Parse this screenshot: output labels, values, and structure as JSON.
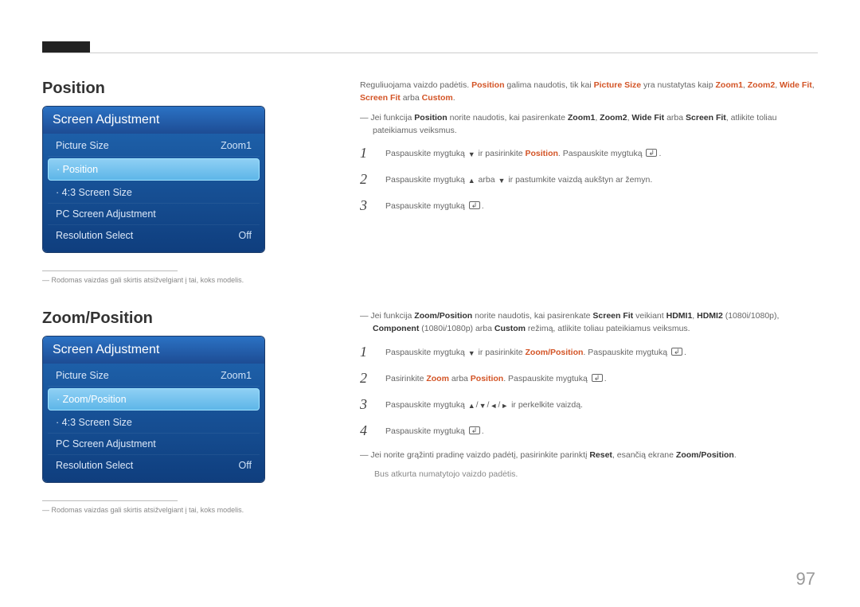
{
  "page_number": "97",
  "section1": {
    "title": "Position",
    "menu": {
      "header": "Screen Adjustment",
      "picture_size_label": "Picture Size",
      "picture_size_value": "Zoom1",
      "selected_label": "Position",
      "four_three_label": "4:3 Screen Size",
      "pc_adjust_label": "PC Screen Adjustment",
      "resolution_label": "Resolution Select",
      "resolution_value": "Off"
    },
    "footnote": "Rodomas vaizdas gali skirtis atsižvelgiant į tai, koks modelis.",
    "intro": {
      "pre": "Reguliuojama vaizdo padėtis. ",
      "hl1": "Position",
      "mid1": " galima naudotis, tik kai ",
      "hl2": "Picture Size",
      "mid2": " yra nustatytas kaip ",
      "hl3": "Zoom1",
      "sep1": ", ",
      "hl4": "Zoom2",
      "sep2": ", ",
      "hl5": "Wide Fit",
      "sep3": ", ",
      "hl6": "Screen Fit",
      "mid3": " arba ",
      "hl7": "Custom",
      "end": "."
    },
    "dash": {
      "pre": "Jei funkcija ",
      "b1": "Position",
      "mid1": " norite naudotis, kai pasirenkate ",
      "b2": "Zoom1",
      "sep1": ", ",
      "b3": "Zoom2",
      "sep2": ", ",
      "b4": "Wide Fit",
      "mid2": " arba ",
      "b5": "Screen Fit",
      "end": ", atlikite toliau pateikiamus veiksmus."
    },
    "steps": {
      "s1": {
        "a": "Paspauskite mygtuką ",
        "b": " ir pasirinkite ",
        "hl": "Position",
        "c": ". Paspauskite mygtuką ",
        "d": "."
      },
      "s2": {
        "a": "Paspauskite mygtuką ",
        "b": " arba ",
        "c": " ir pastumkite vaizdą aukštyn ar žemyn."
      },
      "s3": {
        "a": "Paspauskite mygtuką ",
        "b": "."
      }
    }
  },
  "section2": {
    "title": "Zoom/Position",
    "menu": {
      "header": "Screen Adjustment",
      "picture_size_label": "Picture Size",
      "picture_size_value": "Zoom1",
      "selected_label": "Zoom/Position",
      "four_three_label": "4:3 Screen Size",
      "pc_adjust_label": "PC Screen Adjustment",
      "resolution_label": "Resolution Select",
      "resolution_value": "Off"
    },
    "footnote": "Rodomas vaizdas gali skirtis atsižvelgiant į tai, koks modelis.",
    "dash": {
      "pre": "Jei funkcija ",
      "b1": "Zoom/Position",
      "mid1": " norite naudotis, kai pasirenkate ",
      "b2": "Screen Fit",
      "mid2": " veikiant ",
      "b3": "HDMI1",
      "sep1": ", ",
      "b4": "HDMI2",
      "paren1": " (1080i/1080p), ",
      "b5": "Component",
      "paren2": " (1080i/1080p) arba ",
      "b6": "Custom",
      "end": " režimą, atlikite toliau pateikiamus veiksmus."
    },
    "steps": {
      "s1": {
        "a": "Paspauskite mygtuką ",
        "b": " ir pasirinkite ",
        "hl": "Zoom/Position",
        "c": ". Paspauskite mygtuką ",
        "d": "."
      },
      "s2": {
        "a": "Pasirinkite ",
        "hl1": "Zoom",
        "mid": " arba ",
        "hl2": "Position",
        "b": ". Paspauskite mygtuką ",
        "c": "."
      },
      "s3": {
        "a": "Paspauskite mygtuką ",
        "b": " ir perkelkite vaizdą."
      },
      "s4": {
        "a": "Paspauskite mygtuką ",
        "b": "."
      }
    },
    "dash2": {
      "pre": "Jei norite grąžinti pradinę vaizdo padėtį, pasirinkite parinktį ",
      "b1": "Reset",
      "mid": ", esančią ekrane ",
      "b2": "Zoom/Position",
      "end": "."
    },
    "sub": "Bus atkurta numatytojo vaizdo padėtis."
  }
}
